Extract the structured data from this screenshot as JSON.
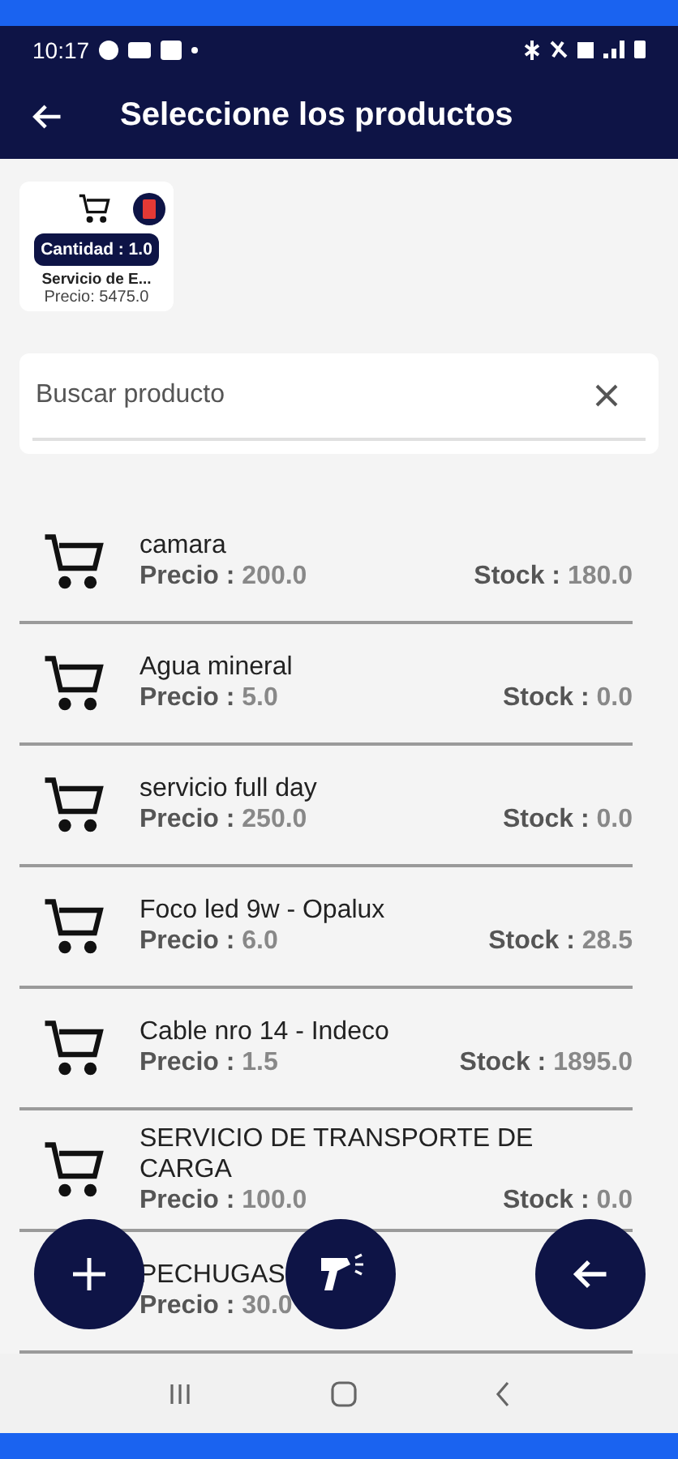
{
  "status_bar": {
    "time": "10:17"
  },
  "toolbar": {
    "title": "Seleccione los productos"
  },
  "cart": [
    {
      "quantity": "Cantidad : 1.0",
      "name": "Servicio de E...",
      "price": "Precio: 5475.0"
    }
  ],
  "search": {
    "placeholder": "Buscar producto"
  },
  "products": [
    {
      "name": "camara",
      "price_label": "Precio :",
      "price": "200.0",
      "stock_label": "Stock :",
      "stock": "180.0"
    },
    {
      "name": "Agua mineral",
      "price_label": "Precio :",
      "price": "5.0",
      "stock_label": "Stock :",
      "stock": "0.0"
    },
    {
      "name": "servicio full day",
      "price_label": "Precio :",
      "price": "250.0",
      "stock_label": "Stock :",
      "stock": "0.0"
    },
    {
      "name": "Foco led 9w - Opalux",
      "price_label": "Precio :",
      "price": "6.0",
      "stock_label": "Stock :",
      "stock": "28.5"
    },
    {
      "name": "Cable nro 14 - Indeco",
      "price_label": "Precio :",
      "price": "1.5",
      "stock_label": "Stock :",
      "stock": "1895.0"
    },
    {
      "name": "SERVICIO DE TRANSPORTE DE CARGA",
      "price_label": "Precio :",
      "price": "100.0",
      "stock_label": "Stock :",
      "stock": "0.0"
    },
    {
      "name": "PECHUGAS",
      "price_label": "Precio :",
      "price": "30.0"
    }
  ]
}
